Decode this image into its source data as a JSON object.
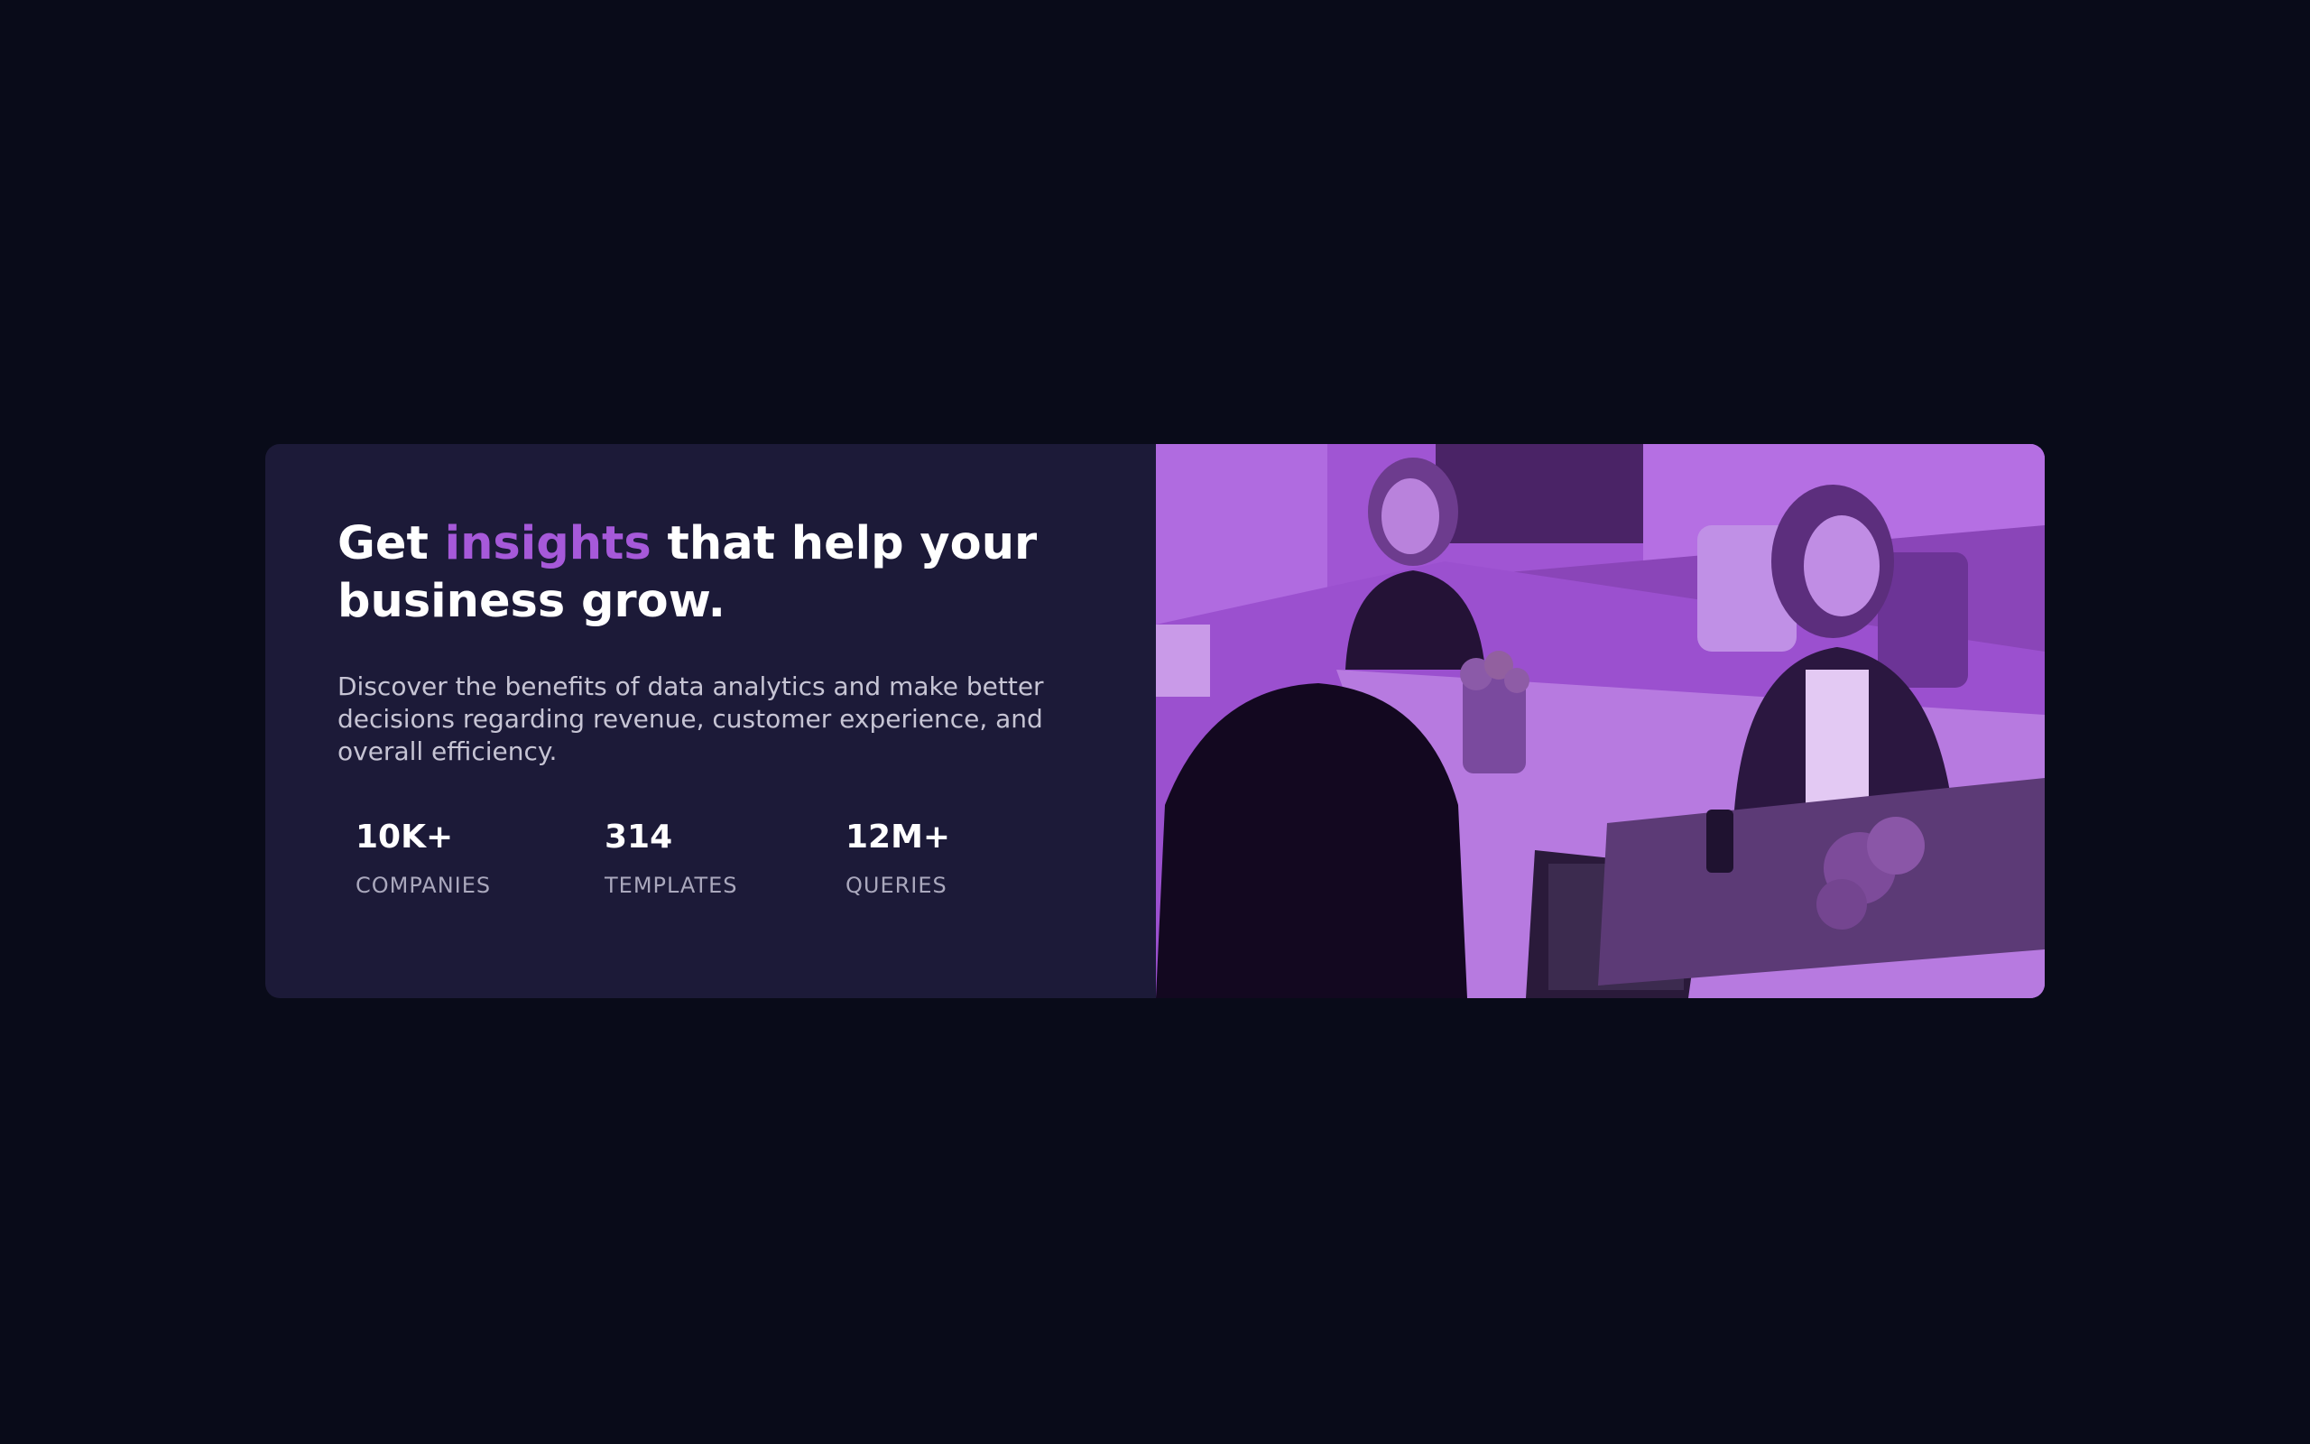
{
  "card": {
    "headline": {
      "before": "Get ",
      "accent": "insights",
      "after": " that help your business grow."
    },
    "description": "Discover the benefits of data analytics and make better decisions regarding revenue, customer experience, and overall efficiency.",
    "stats": [
      {
        "value": "10K+",
        "label": "COMPANIES"
      },
      {
        "value": "314",
        "label": "TEMPLATES"
      },
      {
        "value": "12M+",
        "label": "QUERIES"
      }
    ]
  },
  "colors": {
    "page_background": "#090b19",
    "card_background": "#1c1a38",
    "accent": "#a659d9",
    "image_overlay": "#a055d3"
  },
  "image": {
    "subject": "team-working-at-table-photo"
  }
}
